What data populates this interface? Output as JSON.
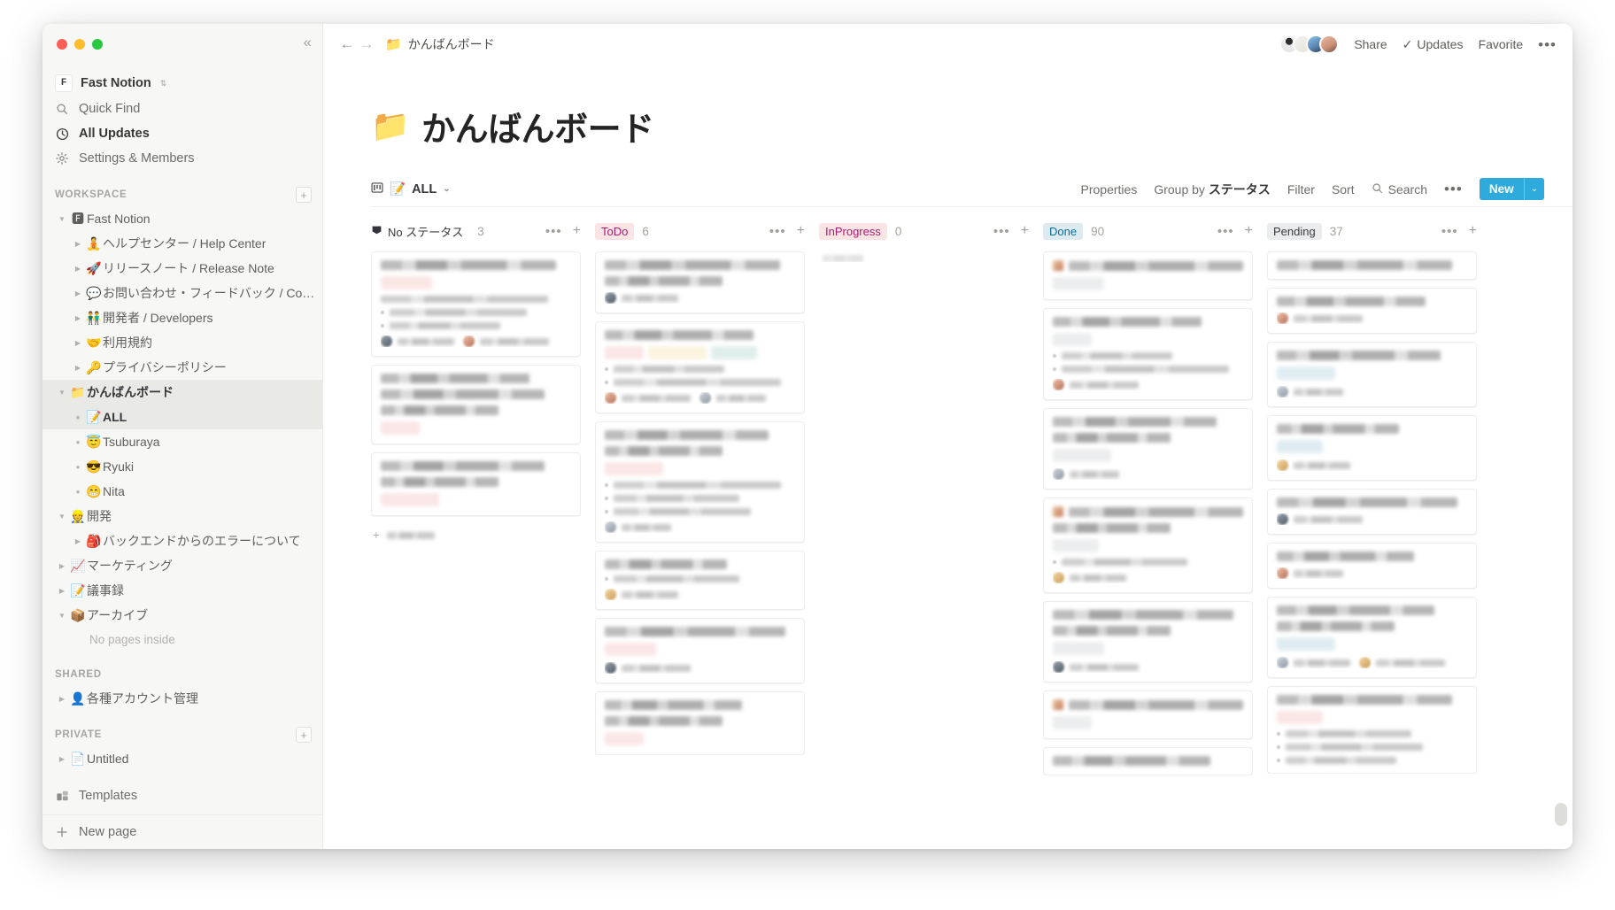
{
  "window": {
    "traffic_lights": [
      "close",
      "minimize",
      "maximize"
    ],
    "collapse_label": "«"
  },
  "sidebar": {
    "workspace_switcher": {
      "logo_text": "F",
      "name": "Fast Notion",
      "caret": "⇅"
    },
    "nav": [
      {
        "icon": "search-icon",
        "label": "Quick Find",
        "strong": false
      },
      {
        "icon": "clock-icon",
        "label": "All Updates",
        "strong": true
      },
      {
        "icon": "gear-icon",
        "label": "Settings & Members",
        "strong": false
      }
    ],
    "workspace_section": {
      "title": "WORKSPACE",
      "add_label": "+"
    },
    "workspace_tree": [
      {
        "arrow": "▼",
        "emoji": "🅵",
        "label": "Fast Notion",
        "indent": 0,
        "bold": false,
        "selected": false
      },
      {
        "arrow": "▶",
        "emoji": "🧘",
        "label": "ヘルプセンター / Help Center",
        "indent": 1,
        "bold": false,
        "selected": false
      },
      {
        "arrow": "▶",
        "emoji": "🚀",
        "label": "リリースノート / Release Note",
        "indent": 1,
        "bold": false,
        "selected": false
      },
      {
        "arrow": "▶",
        "emoji": "💬",
        "label": "お問い合わせ・フィードバック / Co…",
        "indent": 1,
        "bold": false,
        "selected": false
      },
      {
        "arrow": "▶",
        "emoji": "👬",
        "label": "開発者 / Developers",
        "indent": 1,
        "bold": false,
        "selected": false
      },
      {
        "arrow": "▶",
        "emoji": "🤝",
        "label": "利用規約",
        "indent": 1,
        "bold": false,
        "selected": false
      },
      {
        "arrow": "▶",
        "emoji": "🔑",
        "label": "プライバシーポリシー",
        "indent": 1,
        "bold": false,
        "selected": false
      },
      {
        "arrow": "▼",
        "emoji": "📁",
        "label": "かんばんボード",
        "indent": 0,
        "bold": true,
        "selected": true
      },
      {
        "arrow": "•",
        "emoji": "📝",
        "label": "ALL",
        "indent": 1,
        "bold": true,
        "selected": true
      },
      {
        "arrow": "•",
        "emoji": "😇",
        "label": "Tsuburaya",
        "indent": 1,
        "bold": false,
        "selected": false
      },
      {
        "arrow": "•",
        "emoji": "😎",
        "label": "Ryuki",
        "indent": 1,
        "bold": false,
        "selected": false
      },
      {
        "arrow": "•",
        "emoji": "😁",
        "label": "Nita",
        "indent": 1,
        "bold": false,
        "selected": false
      },
      {
        "arrow": "▼",
        "emoji": "👷",
        "label": "開発",
        "indent": 0,
        "bold": false,
        "selected": false
      },
      {
        "arrow": "▶",
        "emoji": "🎒",
        "label": "バックエンドからのエラーについて",
        "indent": 1,
        "bold": false,
        "selected": false
      },
      {
        "arrow": "▶",
        "emoji": "📈",
        "label": "マーケティング",
        "indent": 0,
        "bold": false,
        "selected": false
      },
      {
        "arrow": "▶",
        "emoji": "📝",
        "label": "議事録",
        "indent": 0,
        "bold": false,
        "selected": false
      },
      {
        "arrow": "▼",
        "emoji": "📦",
        "label": "アーカイブ",
        "indent": 0,
        "bold": false,
        "selected": false
      }
    ],
    "archive_empty_note": "No pages inside",
    "shared_section": {
      "title": "SHARED"
    },
    "shared_tree": [
      {
        "arrow": "▶",
        "emoji": "👤",
        "label": "各種アカウント管理",
        "indent": 0
      }
    ],
    "private_section": {
      "title": "PRIVATE",
      "add_label": "+"
    },
    "private_tree": [
      {
        "arrow": "▶",
        "emoji": "📄",
        "label": "Untitled",
        "indent": 0
      }
    ],
    "bottom": [
      {
        "icon": "templates-icon",
        "label": "Templates"
      },
      {
        "icon": "plus-icon",
        "label": "New page"
      }
    ]
  },
  "topbar": {
    "back_arrow": "←",
    "forward_arrow": "→",
    "breadcrumb": {
      "emoji": "📁",
      "label": "かんばんボード"
    },
    "avatars": [
      "member-1",
      "member-2",
      "member-3",
      "member-4"
    ],
    "share_label": "Share",
    "updates_label": "Updates",
    "updates_check": "✓",
    "favorite_label": "Favorite",
    "more_label": "•••"
  },
  "page": {
    "emoji": "📁",
    "title": "かんばんボード"
  },
  "view_bar": {
    "board_icon": "board-icon",
    "tab_emoji": "📝",
    "tab_label": "ALL",
    "tab_caret": "⌄",
    "properties_label": "Properties",
    "group_by_prefix": "Group by ",
    "group_by_value": "ステータス",
    "filter_label": "Filter",
    "sort_label": "Sort",
    "search_label": "Search",
    "more_label": "•••",
    "new_label": "New",
    "new_caret": "⌄",
    "new_color": "#2eaadc"
  },
  "board": {
    "columns": [
      {
        "id": "no-status",
        "label": "No ステータス",
        "count": "3",
        "chip_style": "nostatus",
        "chip_color": "",
        "add_card_label": "New",
        "cards": [
          {
            "tags": [
              "pink"
            ],
            "lines": 1,
            "bullets": 2,
            "people": 2,
            "body": 1
          },
          {
            "tags": [
              "pink"
            ],
            "lines": 3,
            "bullets": 0,
            "people": 0,
            "body": 0
          },
          {
            "tags": [
              "pink"
            ],
            "lines": 2,
            "bullets": 0,
            "people": 0,
            "body": 0
          }
        ]
      },
      {
        "id": "todo",
        "label": "ToDo",
        "count": "6",
        "chip_style": "tag",
        "chip_color": "#fbe4e4",
        "chip_text_color": "#ad1a72",
        "cards": [
          {
            "tags": [],
            "lines": 2,
            "bullets": 0,
            "people": 1,
            "body": 0
          },
          {
            "tags": [
              "pink",
              "yellow",
              "green"
            ],
            "lines": 1,
            "bullets": 2,
            "people": 2,
            "body": 0
          },
          {
            "tags": [
              "pink"
            ],
            "lines": 2,
            "bullets": 3,
            "people": 1,
            "body": 0
          },
          {
            "tags": [],
            "lines": 1,
            "bullets": 1,
            "people": 1,
            "body": 0
          },
          {
            "tags": [
              "pink"
            ],
            "lines": 1,
            "bullets": 0,
            "people": 1,
            "body": 0
          },
          {
            "tags": [
              "pink"
            ],
            "lines": 2,
            "bullets": 0,
            "people": 0,
            "body": 0
          }
        ]
      },
      {
        "id": "inprogress",
        "label": "InProgress",
        "count": "0",
        "chip_style": "tag",
        "chip_color": "#fbe4e4",
        "chip_text_color": "#ad1a72",
        "cards": [],
        "empty_placeholder": true
      },
      {
        "id": "done",
        "label": "Done",
        "count": "90",
        "chip_style": "tag",
        "chip_color": "#ddebf1",
        "chip_text_color": "#0b6e99",
        "cards": [
          {
            "tags": [
              "gray"
            ],
            "lines": 1,
            "bullets": 0,
            "people": 0,
            "body": 0,
            "lead_emoji": true
          },
          {
            "tags": [
              "gray"
            ],
            "lines": 1,
            "bullets": 2,
            "people": 1,
            "body": 0
          },
          {
            "tags": [
              "gray"
            ],
            "lines": 2,
            "bullets": 0,
            "people": 1,
            "body": 0
          },
          {
            "tags": [
              "gray"
            ],
            "lines": 2,
            "bullets": 1,
            "people": 1,
            "body": 0,
            "lead_emoji": true
          },
          {
            "tags": [
              "gray"
            ],
            "lines": 2,
            "bullets": 0,
            "people": 1,
            "body": 0
          },
          {
            "tags": [
              "gray"
            ],
            "lines": 1,
            "bullets": 0,
            "people": 0,
            "body": 0,
            "lead_emoji": true
          },
          {
            "tags": [],
            "lines": 1,
            "bullets": 0,
            "people": 0,
            "body": 0
          }
        ]
      },
      {
        "id": "pending",
        "label": "Pending",
        "count": "37",
        "chip_style": "tag",
        "chip_color": "#ebeced",
        "chip_text_color": "#3c3c3c",
        "cards": [
          {
            "tags": [],
            "lines": 1,
            "bullets": 0,
            "people": 0,
            "body": 0
          },
          {
            "tags": [],
            "lines": 1,
            "bullets": 0,
            "people": 1,
            "body": 0
          },
          {
            "tags": [
              "blue"
            ],
            "lines": 1,
            "bullets": 0,
            "people": 1,
            "body": 0
          },
          {
            "tags": [
              "blue"
            ],
            "lines": 1,
            "bullets": 0,
            "people": 1,
            "body": 0
          },
          {
            "tags": [],
            "lines": 1,
            "bullets": 0,
            "people": 1,
            "body": 0
          },
          {
            "tags": [],
            "lines": 1,
            "bullets": 0,
            "people": 1,
            "body": 0
          },
          {
            "tags": [
              "blue"
            ],
            "lines": 2,
            "bullets": 0,
            "people": 2,
            "body": 0
          },
          {
            "tags": [
              "pink"
            ],
            "lines": 1,
            "bullets": 3,
            "people": 0,
            "body": 0
          }
        ]
      }
    ]
  }
}
